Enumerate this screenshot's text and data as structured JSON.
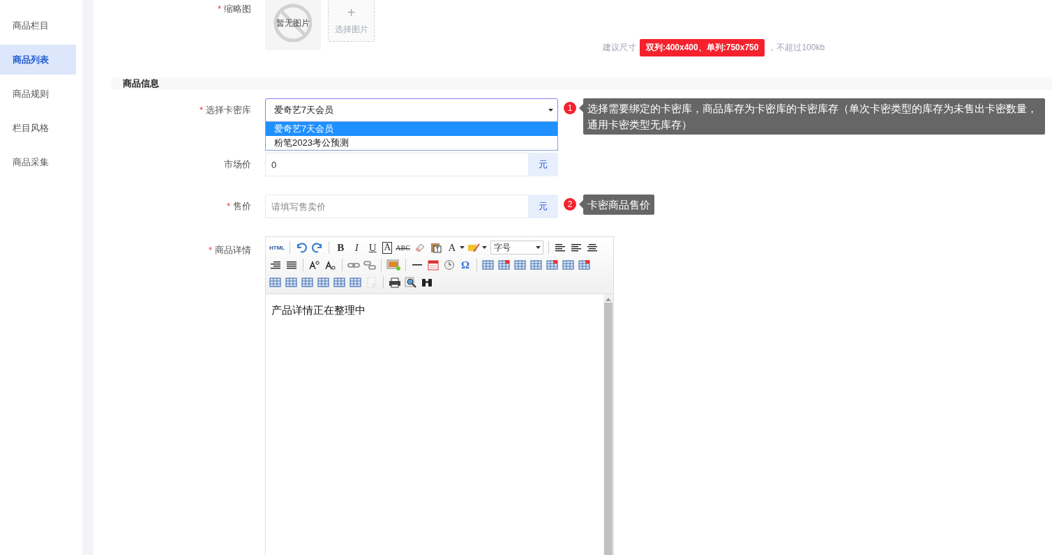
{
  "sidebar": {
    "items": [
      {
        "label": "商品栏目",
        "selected": false
      },
      {
        "label": "商品列表",
        "selected": true
      },
      {
        "label": "商品规则",
        "selected": false
      },
      {
        "label": "栏目风格",
        "selected": false
      },
      {
        "label": "商品采集",
        "selected": false
      }
    ]
  },
  "thumbnail": {
    "label": "缩略图",
    "required_mark": "*",
    "empty_text": "暂无图片",
    "upload_plus": "+",
    "upload_text": "选择图片",
    "hint_before": "建议尺寸",
    "hint_badge": "双列:400x400、单列:750x750",
    "hint_after": "，不超过100kb"
  },
  "section": {
    "title": "商品信息"
  },
  "card_library": {
    "label": "选择卡密库",
    "required_mark": "*",
    "value": "爱奇艺7天会员",
    "expanded": true,
    "options": [
      {
        "label": "爱奇艺7天会员",
        "selected": true
      },
      {
        "label": "粉笔2023考公预测",
        "selected": false
      }
    ],
    "tip_number": "1",
    "tip": "选择需要绑定的卡密库，商品库存为卡密库的卡密库存（单次卡密类型的库存为未售出卡密数量，通用卡密类型无库存）"
  },
  "market_price": {
    "label": "市场价",
    "value": "0",
    "unit": "元"
  },
  "sale_price": {
    "label": "售价",
    "required_mark": "*",
    "placeholder": "请填写售卖价",
    "unit": "元",
    "tip_number": "2",
    "tip": "卡密商品售价"
  },
  "details": {
    "label": "商品详情",
    "required_mark": "*",
    "content": "产品详情正在整理中",
    "toolbar": [
      [
        {
          "kind": "text",
          "label": "HTML"
        },
        {
          "kind": "sep"
        },
        {
          "kind": "icon"
        },
        {
          "kind": "icon"
        },
        {
          "kind": "sep"
        },
        {
          "kind": "text",
          "label": "B"
        },
        {
          "kind": "text",
          "label": "I"
        },
        {
          "kind": "text",
          "label": "U"
        },
        {
          "kind": "text",
          "label": "A"
        },
        {
          "kind": "text",
          "label": "ABC"
        },
        {
          "kind": "icon"
        },
        {
          "kind": "icon"
        },
        {
          "kind": "text",
          "label": "A",
          "dropdown": true
        },
        {
          "kind": "icon",
          "dropdown": true
        },
        {
          "kind": "select",
          "label": "字号"
        },
        {
          "kind": "sep"
        },
        {
          "kind": "icon"
        },
        {
          "kind": "icon"
        },
        {
          "kind": "icon"
        }
      ],
      [
        {
          "kind": "icon"
        },
        {
          "kind": "icon"
        },
        {
          "kind": "sep"
        },
        {
          "kind": "icon"
        },
        {
          "kind": "icon"
        },
        {
          "kind": "sep"
        },
        {
          "kind": "icon"
        },
        {
          "kind": "icon"
        },
        {
          "kind": "sep"
        },
        {
          "kind": "icon"
        },
        {
          "kind": "sep"
        },
        {
          "kind": "icon"
        },
        {
          "kind": "icon"
        },
        {
          "kind": "icon"
        },
        {
          "kind": "text",
          "label": "Ω"
        },
        {
          "kind": "sep"
        },
        {
          "kind": "icon"
        },
        {
          "kind": "icon"
        },
        {
          "kind": "icon"
        },
        {
          "kind": "icon"
        },
        {
          "kind": "icon"
        },
        {
          "kind": "icon"
        },
        {
          "kind": "icon"
        }
      ],
      [
        {
          "kind": "icon"
        },
        {
          "kind": "icon"
        },
        {
          "kind": "icon"
        },
        {
          "kind": "icon"
        },
        {
          "kind": "icon"
        },
        {
          "kind": "icon"
        },
        {
          "kind": "icon",
          "disabled": true
        },
        {
          "kind": "sep"
        },
        {
          "kind": "icon"
        },
        {
          "kind": "icon"
        },
        {
          "kind": "icon"
        }
      ]
    ]
  }
}
